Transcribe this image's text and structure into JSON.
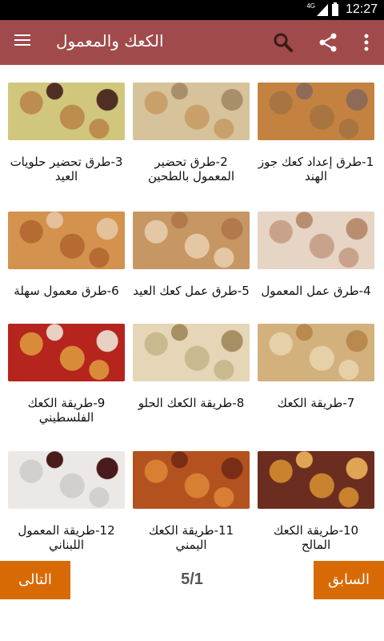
{
  "status": {
    "time": "12:27",
    "network": "4G"
  },
  "appbar": {
    "title": "الكعك والمعمول",
    "icons": [
      "menu-icon",
      "search-icon",
      "share-icon",
      "more-vert-icon"
    ]
  },
  "items": [
    {
      "caption": "1-طرق إعداد كعك جوز الهند",
      "thumb_colors": [
        "#c48240",
        "#a8743f",
        "#8e6b56"
      ]
    },
    {
      "caption": "2-طرق تحضير المعمول بالطحين",
      "thumb_colors": [
        "#d7c39b",
        "#c9a06a",
        "#a98e6a"
      ]
    },
    {
      "caption": "3-طرق تحضير حلويات العيد",
      "thumb_colors": [
        "#d1c77c",
        "#bd8d4d",
        "#4f2f24"
      ]
    },
    {
      "caption": "4-طرق عمل المعمول",
      "thumb_colors": [
        "#e6d4c4",
        "#c9a28b",
        "#b98d70"
      ]
    },
    {
      "caption": "5-طرق عمل كعك العيد",
      "thumb_colors": [
        "#c69663",
        "#e4c7a3",
        "#b27a4c"
      ]
    },
    {
      "caption": "6-طرق معمول سهلة",
      "thumb_colors": [
        "#d3924e",
        "#b56b31",
        "#e4c19a"
      ]
    },
    {
      "caption": "7-طريقة الكعك",
      "thumb_colors": [
        "#d2b17d",
        "#e6d0a7",
        "#b98a4e"
      ]
    },
    {
      "caption": "8-طريقة الكعك الحلو",
      "thumb_colors": [
        "#e4d6b6",
        "#c9b98e",
        "#a88f63"
      ]
    },
    {
      "caption": "9-طريقة الكعك الفلسطيني",
      "thumb_colors": [
        "#b5241d",
        "#d98b3a",
        "#e6d1c4"
      ]
    },
    {
      "caption": "10-طريقة الكعك المالح",
      "thumb_colors": [
        "#6b2d1f",
        "#c9832f",
        "#e0a553"
      ]
    },
    {
      "caption": "11-طريقة الكعك اليمني",
      "thumb_colors": [
        "#b4521f",
        "#d77f33",
        "#7a2d16"
      ]
    },
    {
      "caption": "12-طريقة المعمول اللبناني",
      "thumb_colors": [
        "#ebe8e6",
        "#d2cfcd",
        "#4a1b1c"
      ]
    }
  ],
  "pagination": {
    "prev_label": "السابق",
    "next_label": "التالى",
    "page": "5/1"
  },
  "colors": {
    "appbar": "#a14a4c",
    "button": "#d86a06"
  }
}
